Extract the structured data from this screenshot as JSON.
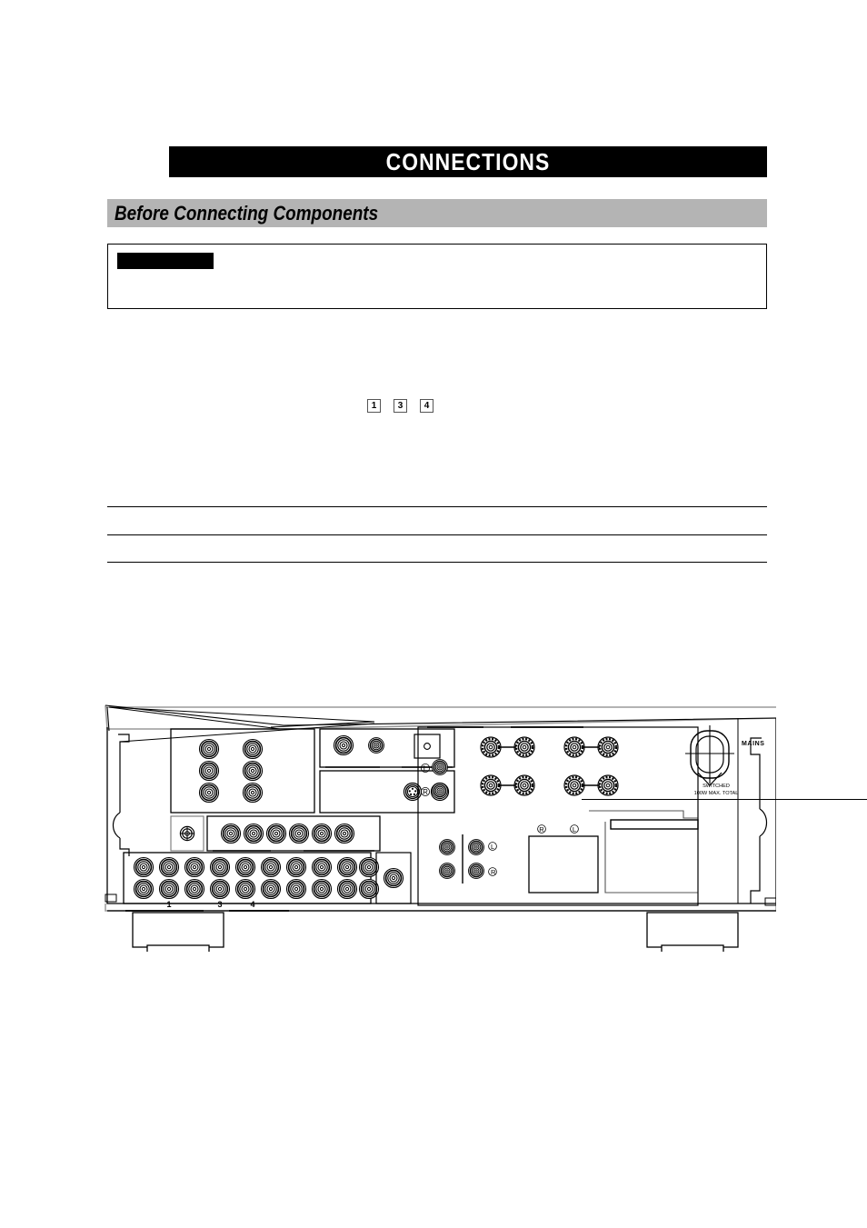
{
  "page": {
    "chapter_title": "CONNECTIONS",
    "section_heading": "Before Connecting Components"
  },
  "note_box": {
    "redacted_label": ""
  },
  "reference_numbers": [
    "1",
    "3",
    "4"
  ],
  "rules": {
    "count": 3
  },
  "diagram": {
    "caption": "",
    "labels": {
      "mains": "MAINS",
      "switched": "SWITCHED",
      "switched_rating": "100W MAX. TOTAL",
      "jack_group_numbers": [
        "1",
        "3",
        "4"
      ],
      "channel_left": "L",
      "channel_right": "R",
      "speaker_left": "L",
      "speaker_right": "R"
    },
    "colors": {
      "outline": "#000000",
      "panel_edge": "#9a9a9a",
      "fill": "#ffffff"
    }
  }
}
